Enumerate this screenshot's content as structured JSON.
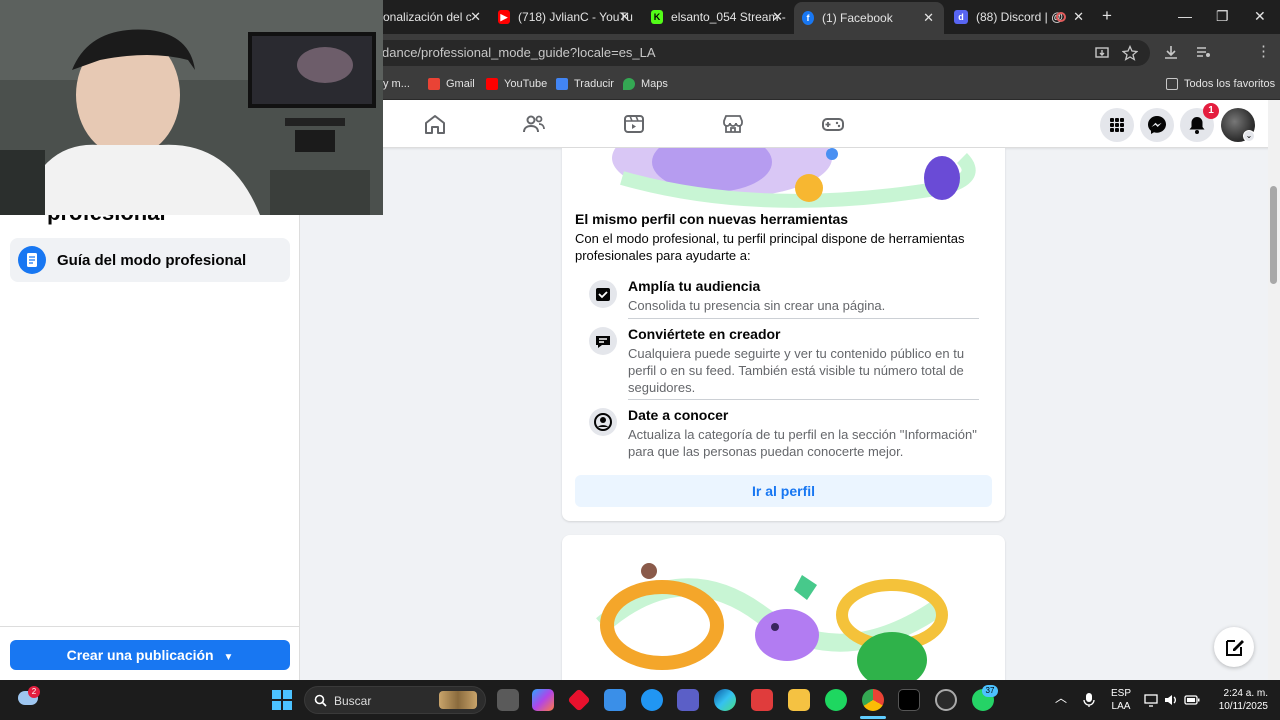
{
  "browser": {
    "tabs": [
      {
        "title": "onalización del c",
        "active": false
      },
      {
        "title": "(718) JvlianC - YouTu",
        "active": false
      },
      {
        "title": "elsanto_054 Stream -",
        "active": false
      },
      {
        "title": "(1) Facebook",
        "active": true
      },
      {
        "title": "(88) Discord | @",
        "active": false
      }
    ],
    "url": "dance/professional_mode_guide?locale=es_LA",
    "bookmarks": [
      "y m...",
      "Gmail",
      "YouTube",
      "Traducir",
      "Maps"
    ],
    "bookmarks_right": "Todos los favoritos",
    "new_tab": "+",
    "minimize": "—",
    "restore": "❐",
    "close": "✕"
  },
  "facebook": {
    "notification_count": "1",
    "sidebar": {
      "title": "profesional",
      "item_label": "Guía del modo profesional",
      "create_label": "Crear una publicación"
    },
    "card": {
      "heading": "El mismo perfil con nuevas herramientas",
      "description": "Con el modo profesional, tu perfil principal dispone de herramientas profesionales para ayudarte a:",
      "features": [
        {
          "title": "Amplía tu audiencia",
          "desc": "Consolida tu presencia sin crear una página."
        },
        {
          "title": "Conviértete en creador",
          "desc": "Cualquiera puede seguirte y ver tu contenido público en tu perfil o en su feed. También está visible tu número total de seguidores."
        },
        {
          "title": "Date a conocer",
          "desc": "Actualiza la categoría de tu perfil en la sección \"Información\" para que las personas puedan conocerte mejor."
        }
      ],
      "button_label": "Ir al perfil"
    }
  },
  "taskbar": {
    "search_placeholder": "Buscar",
    "weather_badge": "2",
    "whatsapp_badge": "37",
    "lang_top": "ESP",
    "lang_bottom": "LAA",
    "time": "2:24 a. m.",
    "date": "10/11/2025"
  },
  "colors": {
    "brand": "#1877f2",
    "badge": "#e41e3f"
  }
}
